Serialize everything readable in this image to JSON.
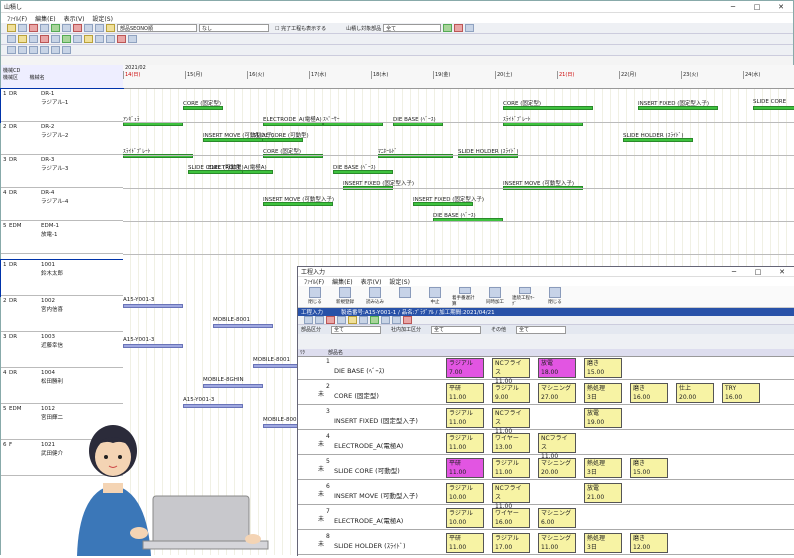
{
  "window": {
    "title": "山積し"
  },
  "menu": [
    "ﾌｧｲﾙ(F)",
    "編集(E)",
    "表示(V)",
    "設定(S)"
  ],
  "toolbar": {
    "select1": "部品SEONO順",
    "select2": "なし",
    "checkbox": "完了工程も表示する",
    "filter_label": "山積し対象部品",
    "filter_value": "全て"
  },
  "gantt": {
    "col_headers": {
      "no": "No.",
      "code_label": "機械CD",
      "name_label": "機械名",
      "type": "機械区"
    },
    "date_label": "2021/02",
    "days": [
      "14(日)",
      "15(月)",
      "16(火)",
      "17(水)",
      "18(木)",
      "19(金)",
      "20(土)",
      "21(日)",
      "22(月)",
      "23(火)",
      "24(水)"
    ],
    "machines": [
      {
        "no": "1",
        "type": "DR",
        "code": "DR-1",
        "name": "ラジアル-1"
      },
      {
        "no": "2",
        "type": "DR",
        "code": "DR-2",
        "name": "ラジアル-2"
      },
      {
        "no": "3",
        "type": "DR",
        "code": "DR-3",
        "name": "ラジアル-3"
      },
      {
        "no": "4",
        "type": "DR",
        "code": "DR-4",
        "name": "ラジアル-4"
      },
      {
        "no": "5",
        "type": "EDM",
        "code": "EDM-1",
        "name": "放電-1"
      }
    ],
    "workers": [
      {
        "no": "1",
        "type": "DR",
        "code": "1001",
        "name": "鈴木太郎"
      },
      {
        "no": "2",
        "type": "DR",
        "code": "1002",
        "name": "宮内信喜"
      },
      {
        "no": "3",
        "type": "DR",
        "code": "1003",
        "name": "近藤幸信"
      },
      {
        "no": "4",
        "type": "DR",
        "code": "1004",
        "name": "松田勝利"
      },
      {
        "no": "5",
        "type": "EDM",
        "code": "1012",
        "name": "宮田輝二"
      },
      {
        "no": "6",
        "type": "F",
        "code": "1021",
        "name": "武田健介"
      }
    ],
    "bar_labels": [
      "CORE (固定型)",
      "SLIDE CORE (可動型)",
      "ｽﾍﾟｰｻｰ",
      "CORE (固定型)",
      "INSERT FIXED (固定型入子)",
      "SLIDE CORE",
      "ｱﾝｷﾞｭﾗ",
      "ELECTRODE_A(電極A)",
      "DIE BASE (ﾍﾞｰｽ)",
      "ｽﾗｲﾄﾞﾌﾟﾚｰﾄ",
      "SLIDE HOLDER (ｽﾗｲﾄﾞ)",
      "ﾏﾆﾎｰﾙﾄﾞ",
      "INSERT MOVE (可動型入子)",
      "INSERT FIXED (固定型入子)",
      "A15-Y001-3",
      "MOBILE-8001",
      "MOBILE-8GHIN"
    ]
  },
  "sub": {
    "title": "工程入力",
    "menu": [
      "ﾌｧｲﾙ(F)",
      "編集(E)",
      "表示(V)",
      "設定(S)"
    ],
    "buttons": [
      "閉じる",
      "新規登録",
      "読み込み",
      "",
      "中止",
      "着手番遅計算",
      "同時加工",
      "連続工程ﾏｰｸﾞ",
      "閉じる"
    ],
    "bluebar": [
      "工程入力",
      "製造番号:A15-Y001-1 / 品名:ﾌﾟﾗｸﾞｱﾙ / 加工期間:2021/04/21"
    ],
    "info": {
      "part_label": "部品区分",
      "part_val": "全て",
      "proc_label": "社内加工区分",
      "proc_val": "全て",
      "other_label": "その他",
      "other_val": "全て"
    },
    "cols": [
      "ﾜｸ",
      "図番",
      "部品名"
    ],
    "parts": [
      {
        "n": "1",
        "st": "",
        "name": "DIE BASE (ﾍﾞｰｽ)"
      },
      {
        "n": "2",
        "st": "未",
        "name": "CORE (固定型)"
      },
      {
        "n": "3",
        "st": "",
        "name": "INSERT FIXED (固定型入子)"
      },
      {
        "n": "4",
        "st": "未",
        "name": "ELECTRODE_A(電極A)"
      },
      {
        "n": "5",
        "st": "未",
        "name": "SLIDE CORE (可動型)"
      },
      {
        "n": "6",
        "st": "未",
        "name": "INSERT MOVE (可動型入子)"
      },
      {
        "n": "7",
        "st": "未",
        "name": "ELECTRODE_A(電極A)"
      },
      {
        "n": "8",
        "st": "未",
        "name": "SLIDE HOLDER (ｽﾗｲﾄﾞ)"
      }
    ],
    "steps": [
      [
        [
          "ラジアル",
          "7.00",
          "mag"
        ],
        [
          "NCフライス",
          "11.00",
          ""
        ],
        [
          "放電",
          "18.00",
          "mag"
        ],
        [
          "磨き",
          "15.00",
          ""
        ]
      ],
      [
        [
          "平研",
          "11.00",
          ""
        ],
        [
          "ラジアル",
          "9.00",
          ""
        ],
        [
          "マシニング",
          "27.00",
          ""
        ],
        [
          "熱処理",
          "3日",
          ""
        ],
        [
          "磨き",
          "16.00",
          ""
        ],
        [
          "仕上",
          "20.00",
          ""
        ],
        [
          "TRY",
          "16.00",
          ""
        ]
      ],
      [
        [
          "ラジアル",
          "11.00",
          ""
        ],
        [
          "NCフライス",
          "11.00",
          ""
        ],
        [
          "",
          "",
          ""
        ],
        [
          "放電",
          "19.00",
          ""
        ]
      ],
      [
        [
          "ラジアル",
          "11.00",
          ""
        ],
        [
          "ワイヤー",
          "13.00",
          ""
        ],
        [
          "NCフライス",
          "11.00",
          ""
        ]
      ],
      [
        [
          "平研",
          "11.00",
          "mag"
        ],
        [
          "ラジアル",
          "11.00",
          ""
        ],
        [
          "マシニング",
          "20.00",
          ""
        ],
        [
          "熱処理",
          "3日",
          ""
        ],
        [
          "磨き",
          "15.00",
          ""
        ]
      ],
      [
        [
          "ラジアル",
          "10.00",
          ""
        ],
        [
          "NCフライス",
          "11.00",
          ""
        ],
        [
          "",
          "",
          ""
        ],
        [
          "放電",
          "21.00",
          ""
        ]
      ],
      [
        [
          "ラジアル",
          "10.00",
          ""
        ],
        [
          "ワイヤー",
          "16.00",
          ""
        ],
        [
          "マシニング",
          "6.00",
          ""
        ]
      ],
      [
        [
          "平研",
          "11.00",
          ""
        ],
        [
          "ラジアル",
          "17.00",
          ""
        ],
        [
          "マシニング",
          "11.00",
          ""
        ],
        [
          "熱処理",
          "3日",
          ""
        ],
        [
          "磨き",
          "12.00",
          ""
        ]
      ]
    ]
  }
}
